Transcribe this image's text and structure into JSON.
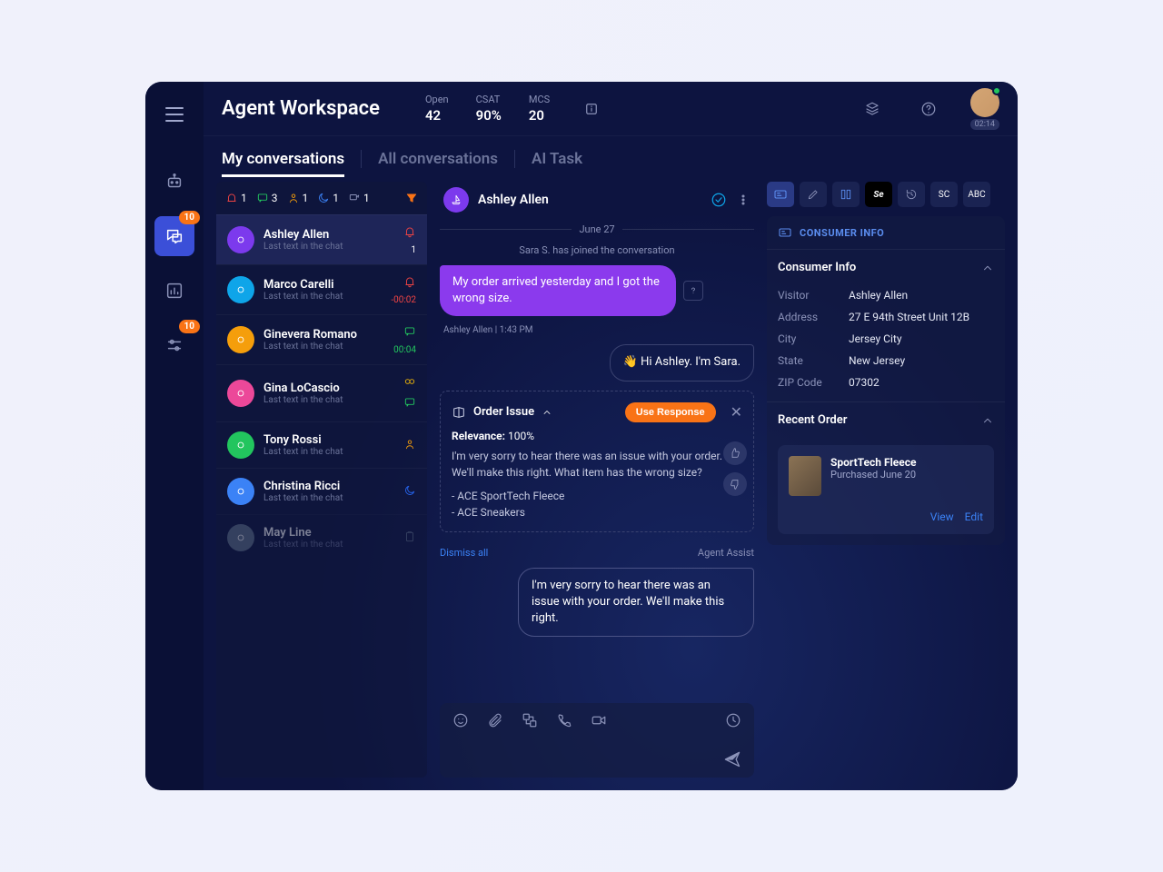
{
  "header": {
    "title": "Agent Workspace",
    "kpis": [
      {
        "label": "Open",
        "value": "42"
      },
      {
        "label": "CSAT",
        "value": "90%"
      },
      {
        "label": "MCS",
        "value": "20"
      }
    ],
    "avatar_time": "02:14"
  },
  "sidebar": {
    "badges": {
      "chat": "10",
      "settings": "10"
    }
  },
  "tabs": [
    "My conversations",
    "All conversations",
    "AI Task"
  ],
  "list_filters": {
    "bell": "1",
    "chat": "3",
    "user": "1",
    "moon": "1",
    "forward": "1"
  },
  "conversations": [
    {
      "name": "Ashley Allen",
      "sub": "Last text in the chat",
      "avatarColor": "#7c3aed",
      "iconColor": "#ef4444",
      "rightIcon": "bell",
      "count": "1",
      "active": true
    },
    {
      "name": "Marco Carelli",
      "sub": "Last text in the chat",
      "avatarColor": "#0ea5e9",
      "iconColor": "#ef4444",
      "rightIcon": "bell",
      "time": "-00:02",
      "timeClass": "neg"
    },
    {
      "name": "Ginevera Romano",
      "sub": "Last text in the chat",
      "avatarColor": "#f59e0b",
      "iconColor": "#22c55e",
      "rightIcon": "chat",
      "time": "00:04",
      "timeClass": "pos"
    },
    {
      "name": "Gina LoCascio",
      "sub": "Last text in the chat",
      "avatarColor": "#ec4899",
      "iconColor": "#eab308",
      "rightIcon": "link",
      "secondary": true
    },
    {
      "name": "Tony Rossi",
      "sub": "Last text in the chat",
      "avatarColor": "#22c55e",
      "iconColor": "#f59e0b",
      "rightIcon": "user"
    },
    {
      "name": "Christina Ricci",
      "sub": "Last text in the chat",
      "avatarColor": "#3b82f6",
      "iconColor": "#2563eb",
      "rightIcon": "moon"
    },
    {
      "name": "May Line",
      "sub": "Last text in the chat",
      "avatarColor": "#64748b",
      "iconColor": "#64748b",
      "rightIcon": "clip",
      "dim": true
    }
  ],
  "chat": {
    "name": "Ashley Allen",
    "date": "June 27",
    "joined": "Sara S. has joined the conversation",
    "msg1": "My order arrived yesterday and I got the wrong size.",
    "msg1_meta": "Ashley Allen  |  1:43 PM",
    "reply1": "👋 Hi Ashley. I'm Sara.",
    "reply2": "I'm very sorry to hear there was an issue with your order. We'll make this right."
  },
  "assist": {
    "title": "Order Issue",
    "button": "Use Response",
    "relevance_label": "Relevance:",
    "relevance_value": "100%",
    "body_line1": "I'm very sorry to hear there was an issue with your order. We'll make this right. What item has the wrong size?",
    "body_line2": "- ACE SportTech Fleece",
    "body_line3": "- ACE Sneakers",
    "dismiss": "Dismiss all",
    "label": "Agent Assist"
  },
  "info": {
    "panel_title": "CONSUMER INFO",
    "section1": "Consumer Info",
    "fields": [
      {
        "k": "Visitor",
        "v": "Ashley Allen"
      },
      {
        "k": "Address",
        "v": "27 E 94th Street Unit 12B"
      },
      {
        "k": "City",
        "v": "Jersey City"
      },
      {
        "k": "State",
        "v": "New Jersey"
      },
      {
        "k": "ZIP Code",
        "v": "07302"
      }
    ],
    "section2": "Recent Order",
    "order": {
      "name": "SportTech Fleece",
      "date": "Purchased June 20",
      "view": "View",
      "edit": "Edit"
    }
  }
}
